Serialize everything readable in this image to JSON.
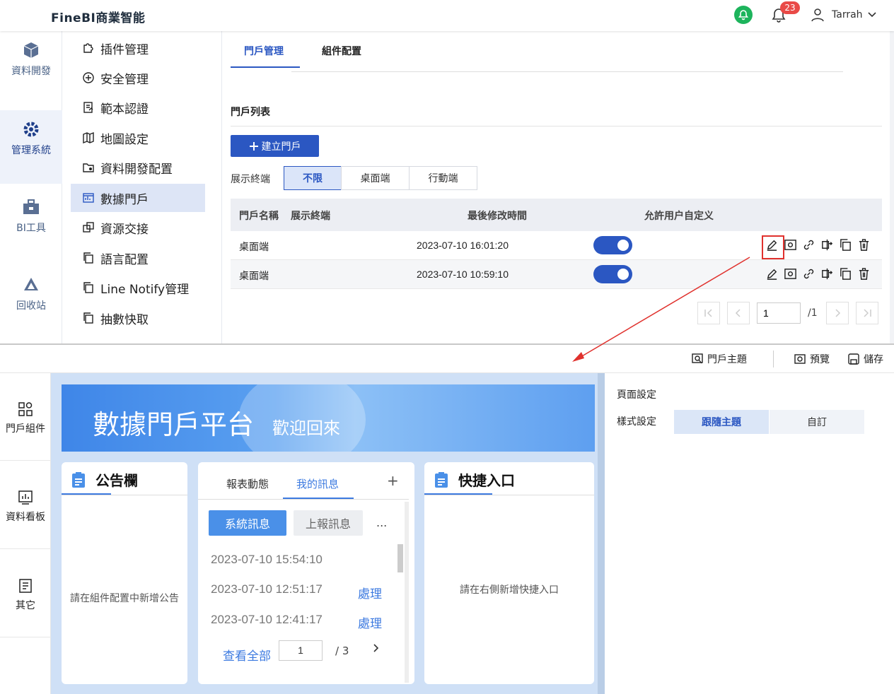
{
  "app": {
    "title": "FineBI商業智能"
  },
  "header": {
    "notification_count": "23",
    "user_name": "Tarrah"
  },
  "left_nav": [
    {
      "label": "資料開發",
      "icon": "cube-icon"
    },
    {
      "label": "管理系統",
      "icon": "gear-icon"
    },
    {
      "label": "BI工具",
      "icon": "toolbox-icon"
    },
    {
      "label": "回收站",
      "icon": "recycle-icon"
    }
  ],
  "sub_nav": [
    {
      "label": "插件管理",
      "icon": "puzzle-icon"
    },
    {
      "label": "安全管理",
      "icon": "shield-icon"
    },
    {
      "label": "範本認證",
      "icon": "certificate-icon"
    },
    {
      "label": "地圖設定",
      "icon": "map-icon"
    },
    {
      "label": "資料開發配置",
      "icon": "folder-gear-icon"
    },
    {
      "label": "數據門戶",
      "icon": "dashboard-icon"
    },
    {
      "label": "資源交接",
      "icon": "exchange-icon"
    },
    {
      "label": "語言配置",
      "icon": "copy-icon"
    },
    {
      "label": "Line Notify管理",
      "icon": "copy-icon"
    },
    {
      "label": "抽數快取",
      "icon": "copy-icon"
    }
  ],
  "tabs": {
    "portal_mgmt": "門戶管理",
    "component_config": "組件配置"
  },
  "portal_list": {
    "title": "門戶列表",
    "create_button": "建立門戶",
    "filter_label": "展示終端",
    "filters": [
      "不限",
      "桌面端",
      "行動端"
    ],
    "columns": [
      "門戶名稱",
      "展示終端",
      "最後修改時間",
      "允許用户自定义"
    ],
    "rows": [
      {
        "name": "桌面端",
        "terminal": "",
        "modified": "2023-07-10 16:01:20",
        "allow_custom": true
      },
      {
        "name": "桌面端",
        "terminal": "",
        "modified": "2023-07-10 10:59:10",
        "allow_custom": true
      }
    ],
    "pager": {
      "current": "1",
      "total": "/1"
    }
  },
  "editor": {
    "toolbar": {
      "theme": "門戶主題",
      "preview": "預覽",
      "save": "儲存"
    },
    "side": [
      {
        "label": "門戶組件",
        "icon": "components-icon"
      },
      {
        "label": "資料看板",
        "icon": "chart-board-icon"
      },
      {
        "label": "其它",
        "icon": "document-icon"
      }
    ],
    "banner": {
      "title": "數據門戶平台",
      "subtitle": "歡迎回來"
    },
    "announce": {
      "title": "公告欄",
      "empty": "請在組件配置中新增公告"
    },
    "messages": {
      "tabs": [
        "報表動態",
        "我的訊息"
      ],
      "add": "+",
      "sys_button": "系統訊息",
      "report_button": "上報訊息",
      "more": "...",
      "items": [
        {
          "time": "2023-07-10 15:54:10",
          "action": ""
        },
        {
          "time": "2023-07-10 12:51:17",
          "action": "處理"
        },
        {
          "time": "2023-07-10 12:41:17",
          "action": "處理"
        }
      ],
      "view_all": "查看全部",
      "page": "1",
      "total": "/ 3"
    },
    "shortcut": {
      "title": "快捷入口",
      "empty": "請在右側新增快捷入口"
    },
    "settings": {
      "page": "頁面設定",
      "style_label": "樣式設定",
      "follow": "跟隨主題",
      "custom": "自訂"
    }
  },
  "colors": {
    "primary": "#2b57c2",
    "accent_red": "#e0312d",
    "success": "#1db45c"
  }
}
